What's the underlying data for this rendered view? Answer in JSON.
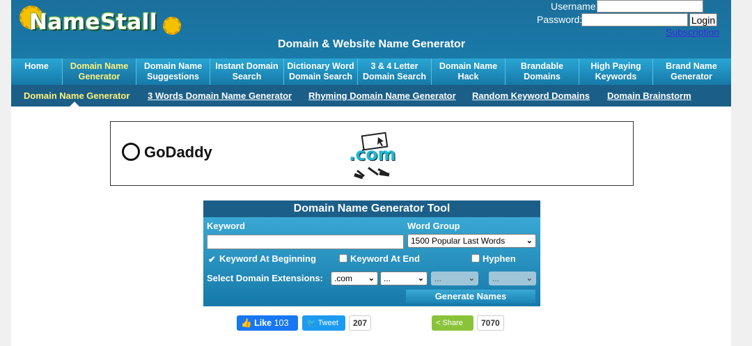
{
  "header": {
    "logo_text": "NameStall",
    "title": "Domain & Website Name Generator",
    "username_label": "Username:",
    "password_label": "Password:",
    "login_button": "Login",
    "subscription_link": "Subscription"
  },
  "nav": {
    "items": [
      {
        "line1": "Home",
        "line2": ""
      },
      {
        "line1": "Domain Name",
        "line2": "Generator"
      },
      {
        "line1": "Domain Name",
        "line2": "Suggestions"
      },
      {
        "line1": "Instant Domain",
        "line2": "Search"
      },
      {
        "line1": "Dictionary Word",
        "line2": "Domain Search"
      },
      {
        "line1": "3 & 4 Letter",
        "line2": "Domain Search"
      },
      {
        "line1": "Domain Name",
        "line2": "Hack"
      },
      {
        "line1": "Brandable",
        "line2": "Domains"
      },
      {
        "line1": "High Paying",
        "line2": "Keywords"
      },
      {
        "line1": "Brand Name",
        "line2": "Generator"
      }
    ]
  },
  "subnav": {
    "items": [
      "Domain Name Generator",
      "3 Words Domain Name Generator",
      "Rhyming Domain Name Generator",
      "Random Keyword Domains",
      "Domain Brainstorm"
    ]
  },
  "ad": {
    "brand": "GoDaddy",
    "graphic_text": ".com"
  },
  "tool": {
    "title": "Domain Name Generator Tool",
    "keyword_label": "Keyword",
    "keyword_value": "",
    "word_group_label": "Word Group",
    "word_group_value": "1500 Popular Last Words",
    "opt_beginning": "Keyword At Beginning",
    "opt_end": "Keyword At End",
    "opt_hyphen": "Hyphen",
    "ext_label": "Select Domain Extensions:",
    "ext1": ".com",
    "ext2": "...",
    "ext3": "...",
    "ext4": "...",
    "generate_button": "Generate Names"
  },
  "social": {
    "like_label": "Like",
    "like_count": "103",
    "tweet_label": "Tweet",
    "tweet_count": "207",
    "share_label": "Share",
    "share_count": "7070"
  },
  "colors": {
    "header": "#1a7aa8",
    "nav": "#2aa6d4",
    "subnav": "#1b5f88",
    "active_text": "#fff27a",
    "link": "#3a2bd6"
  }
}
